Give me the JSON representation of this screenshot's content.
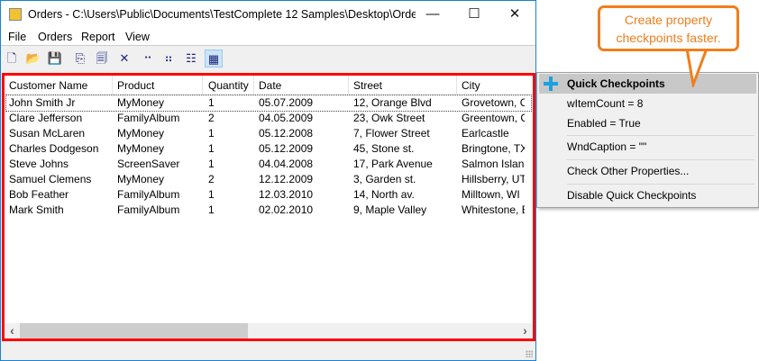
{
  "window": {
    "title": "Orders - C:\\Users\\Public\\Documents\\TestComplete 12 Samples\\Desktop\\Orde...",
    "minimize": "—",
    "maximize": "☐",
    "close": "✕"
  },
  "menubar": [
    "File",
    "Orders",
    "Report",
    "View"
  ],
  "toolbar": [
    {
      "icon": "new-icon",
      "glyph": "🗋"
    },
    {
      "icon": "open-icon",
      "glyph": "📂"
    },
    {
      "icon": "save-icon",
      "glyph": "💾"
    },
    {
      "icon": "copy-icon",
      "glyph": "⎘"
    },
    {
      "icon": "properties-icon",
      "glyph": "🗐"
    },
    {
      "icon": "delete-icon",
      "glyph": "✕"
    },
    {
      "icon": "large-icons-view-icon",
      "glyph": "⠒"
    },
    {
      "icon": "small-icons-view-icon",
      "glyph": "⠶"
    },
    {
      "icon": "list-view-icon",
      "glyph": "☷"
    },
    {
      "icon": "details-view-icon",
      "glyph": "▦"
    }
  ],
  "table": {
    "columns": [
      "Customer Name",
      "Product",
      "Quantity",
      "Date",
      "Street",
      "City"
    ],
    "rows": [
      [
        "John Smith Jr",
        "MyMoney",
        "1",
        "05.07.2009",
        "12, Orange Blvd",
        "Grovetown, CA"
      ],
      [
        "Clare Jefferson",
        "FamilyAlbum",
        "2",
        "04.05.2009",
        "23, Owk Street",
        "Greentown, CA"
      ],
      [
        "Susan McLaren",
        "MyMoney",
        "1",
        "05.12.2008",
        "7, Flower Street",
        "Earlcastle"
      ],
      [
        "Charles Dodgeson",
        "MyMoney",
        "1",
        "05.12.2009",
        "45, Stone st.",
        "Bringtone, TX"
      ],
      [
        "Steve Johns",
        "ScreenSaver",
        "1",
        "04.04.2008",
        "17, Park Avenue",
        "Salmon Island"
      ],
      [
        "Samuel Clemens",
        "MyMoney",
        "2",
        "12.12.2009",
        "3, Garden st.",
        "Hillsberry, UT"
      ],
      [
        "Bob Feather",
        "FamilyAlbum",
        "1",
        "12.03.2010",
        "14, North av.",
        "Milltown, WI"
      ],
      [
        "Mark Smith",
        "FamilyAlbum",
        "1",
        "02.02.2010",
        "9, Maple Valley",
        "Whitestone, British"
      ]
    ]
  },
  "scroll": {
    "left": "‹",
    "right": "›"
  },
  "context_menu": {
    "header": "Quick Checkpoints",
    "items": [
      "wItemCount = 8",
      "Enabled = True",
      "WndCaption = \"\"",
      "Check Other Properties...",
      "Disable Quick Checkpoints"
    ]
  },
  "callout": {
    "line1": "Create property",
    "line2": "checkpoints faster."
  },
  "colors": {
    "highlight_border": "#ff0000",
    "callout": "#f07e1c",
    "plus": "#1ba1e2"
  }
}
